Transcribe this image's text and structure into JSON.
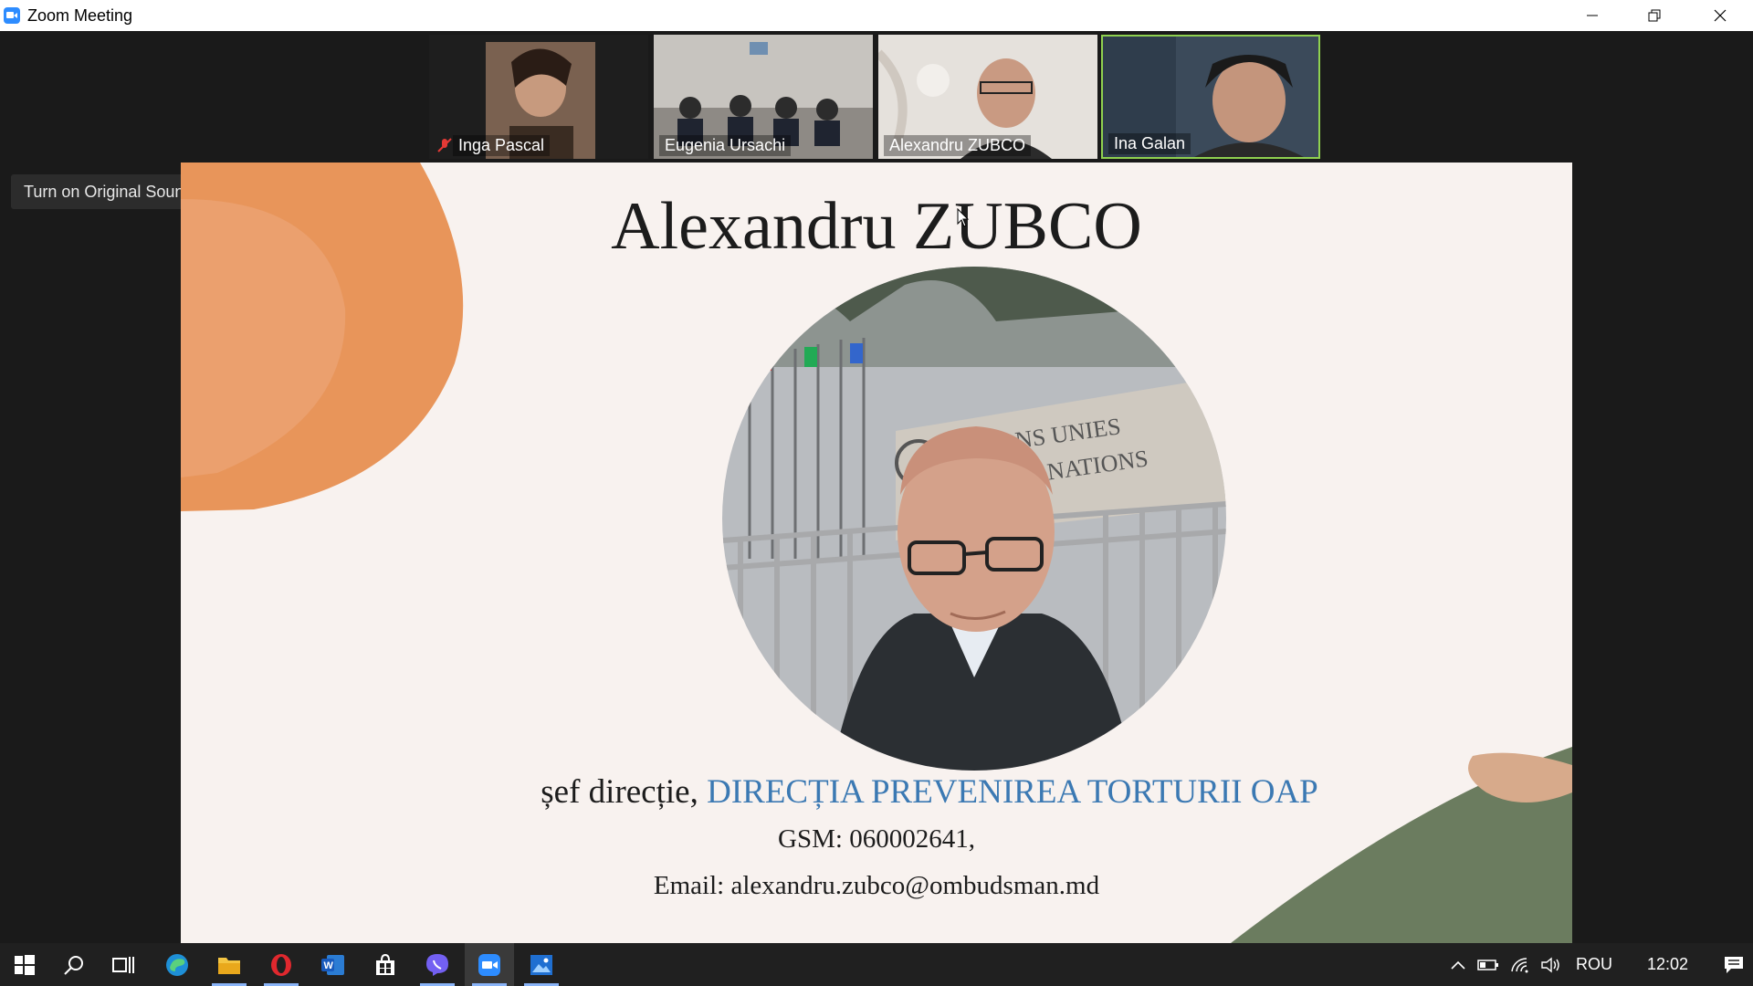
{
  "window": {
    "title": "Zoom Meeting",
    "minimize_icon": "minimize-icon",
    "restore_icon": "restore-icon",
    "close_icon": "close-icon"
  },
  "participants": [
    {
      "name": "Inga Pascal",
      "muted": true,
      "active": false
    },
    {
      "name": "Eugenia Ursachi",
      "muted": false,
      "active": false
    },
    {
      "name": "Alexandru ZUBCO",
      "muted": false,
      "active": false
    },
    {
      "name": "Ina Galan",
      "muted": false,
      "active": true
    }
  ],
  "original_sound": {
    "label": "Turn on Original Sound"
  },
  "slide": {
    "headline": "Alexandru ZUBCO",
    "role_prefix": "șef direcție, ",
    "department": "DIRECȚIA PREVENIREA TORTURII OAP",
    "gsm": "GSM: 060002641,",
    "email": "Email: alexandru.zubco@ombudsman.md",
    "photo_sign_line1": "NATIONS UNIES",
    "photo_sign_line2": "UNITED NATIONS",
    "colors": {
      "orange": "#e8955a",
      "green": "#6b7c5f",
      "tan": "#d7aa8b",
      "link": "#3b79b3"
    }
  },
  "taskbar": {
    "apps": [
      "windows-start-icon",
      "search-icon",
      "task-view-icon",
      "edge-icon",
      "file-explorer-icon",
      "opera-icon",
      "word-icon",
      "store-icon",
      "viber-icon",
      "zoom-icon",
      "photos-icon"
    ],
    "language": "ROU",
    "time": "12:02"
  }
}
